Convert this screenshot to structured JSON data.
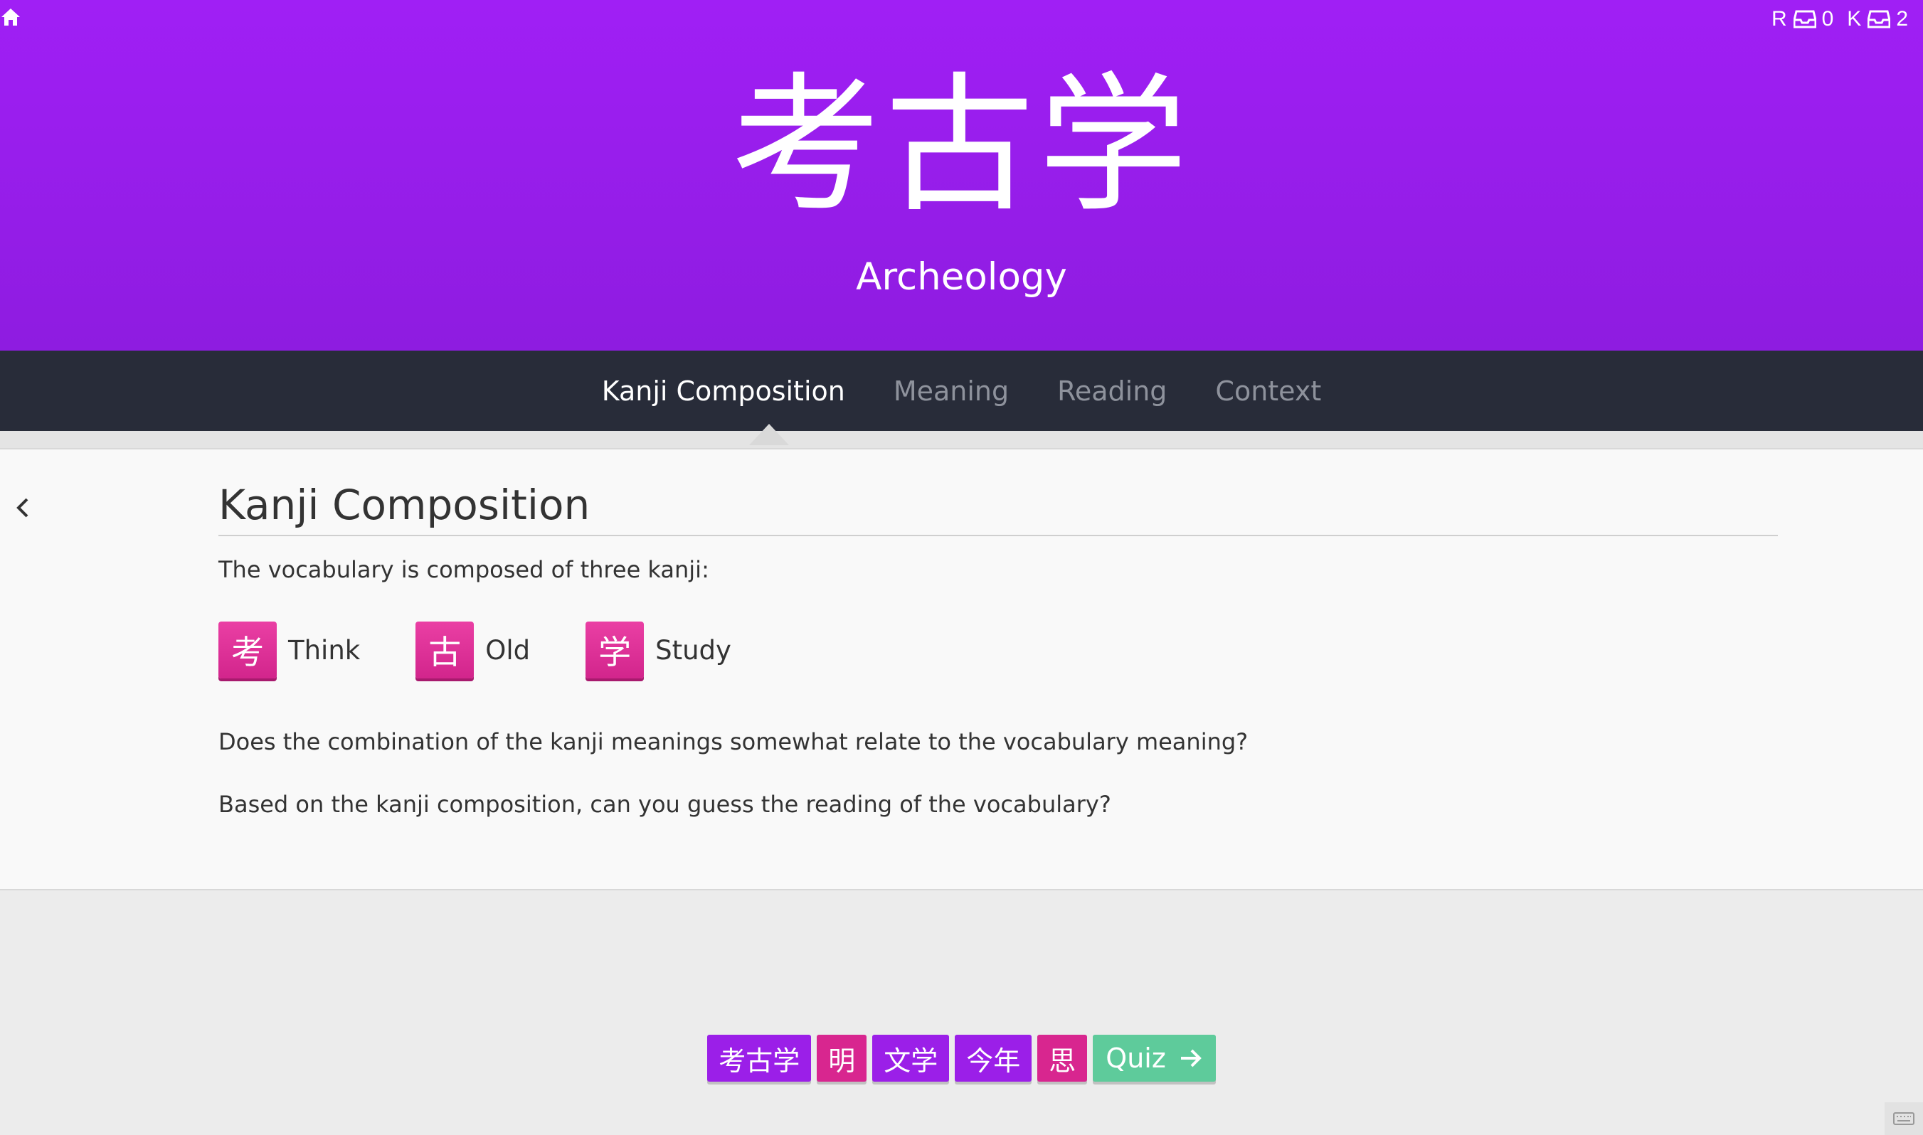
{
  "header": {
    "vocab": "考古学",
    "meaning": "Archeology",
    "counters": [
      {
        "label": "R",
        "count": "0"
      },
      {
        "label": "K",
        "count": "2"
      }
    ],
    "background_color": "#9b1ff0"
  },
  "nav": {
    "tabs": [
      {
        "label": "Kanji Composition",
        "active": true
      },
      {
        "label": "Meaning",
        "active": false
      },
      {
        "label": "Reading",
        "active": false
      },
      {
        "label": "Context",
        "active": false
      }
    ]
  },
  "content": {
    "title": "Kanji Composition",
    "intro": "The vocabulary is composed of three kanji:",
    "kanji": [
      {
        "char": "考",
        "meaning": "Think"
      },
      {
        "char": "古",
        "meaning": "Old"
      },
      {
        "char": "学",
        "meaning": "Study"
      }
    ],
    "questions": [
      "Does the combination of the kanji meanings somewhat relate to the vocabulary meaning?",
      "Based on the kanji composition, can you guess the reading of the vocabulary?"
    ]
  },
  "queue": [
    {
      "text": "考古学",
      "kind": "vocabulary"
    },
    {
      "text": "明",
      "kind": "kanji"
    },
    {
      "text": "文学",
      "kind": "vocabulary"
    },
    {
      "text": "今年",
      "kind": "vocabulary"
    },
    {
      "text": "思",
      "kind": "kanji"
    }
  ],
  "quiz_button": {
    "label": "Quiz"
  },
  "icons": {
    "home": "home-icon",
    "inbox": "inbox-icon",
    "back": "chevron-left-icon",
    "arrow": "arrow-right-icon",
    "keyboard": "keyboard-icon"
  },
  "colors": {
    "kanji": "#d8268f",
    "vocabulary": "#9b1fe8",
    "quiz": "#5ecb9b",
    "nav": "#282c39"
  }
}
